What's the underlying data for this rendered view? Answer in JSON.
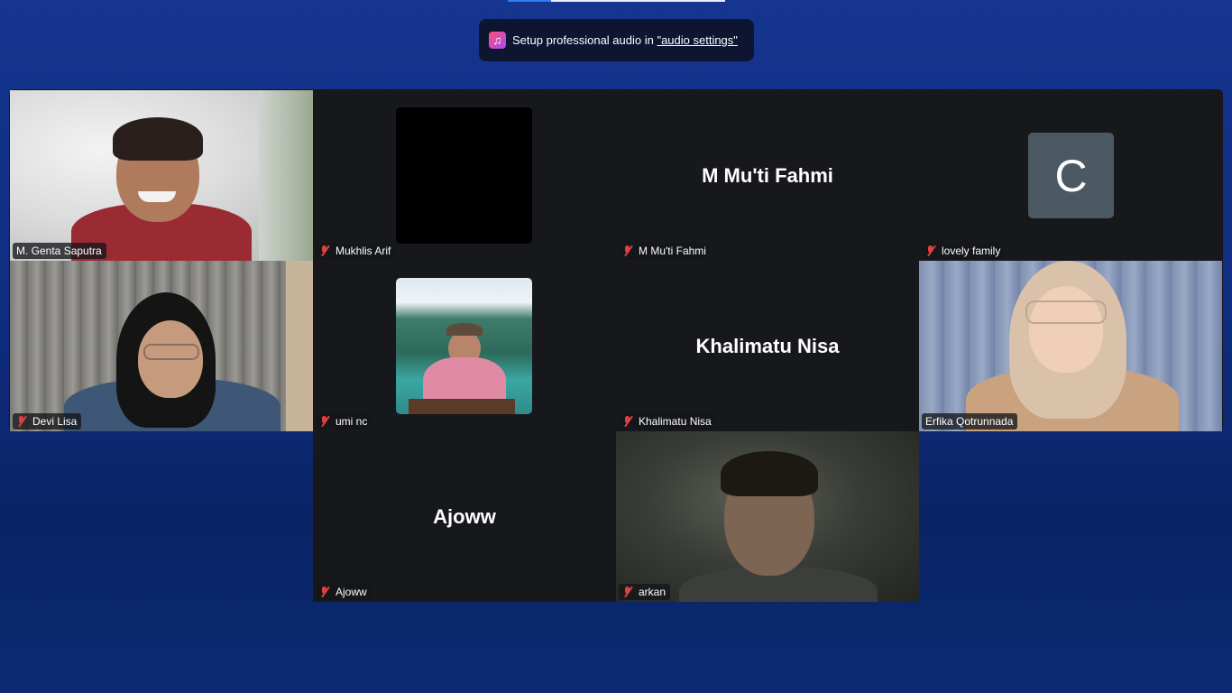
{
  "top_bar": {
    "progress": 0.2
  },
  "banner": {
    "icon": "music-note-icon",
    "text": "Setup professional audio in ",
    "link": "\"audio settings\""
  },
  "participants": [
    {
      "name": "M. Genta Saputra",
      "muted": false,
      "video": true,
      "active_speaker": true
    },
    {
      "name": "Mukhlis Arif",
      "muted": true,
      "video": false,
      "display": "black-square"
    },
    {
      "name": "M Mu'ti Fahmi",
      "muted": true,
      "video": false,
      "display_name": "M Mu'ti Fahmi"
    },
    {
      "name": "lovely family",
      "muted": true,
      "video": false,
      "avatar_letter": "C"
    },
    {
      "name": "Devi Lisa",
      "muted": true,
      "video": true
    },
    {
      "name": "umi nc",
      "muted": true,
      "video": false,
      "display": "profile-photo"
    },
    {
      "name": "Khalimatu Nisa",
      "muted": true,
      "video": false,
      "display_name": "Khalimatu Nisa"
    },
    {
      "name": "Erfika Qotrunnada",
      "muted": false,
      "video": true
    },
    {
      "name": "Ajoww",
      "muted": true,
      "video": false,
      "display_name": "Ajoww"
    },
    {
      "name": "arkan",
      "muted": true,
      "video": true
    }
  ],
  "colors": {
    "background": "#15358f",
    "tile": "#16181c",
    "active_border": "#35d58c",
    "mute_icon": "#e04040"
  }
}
